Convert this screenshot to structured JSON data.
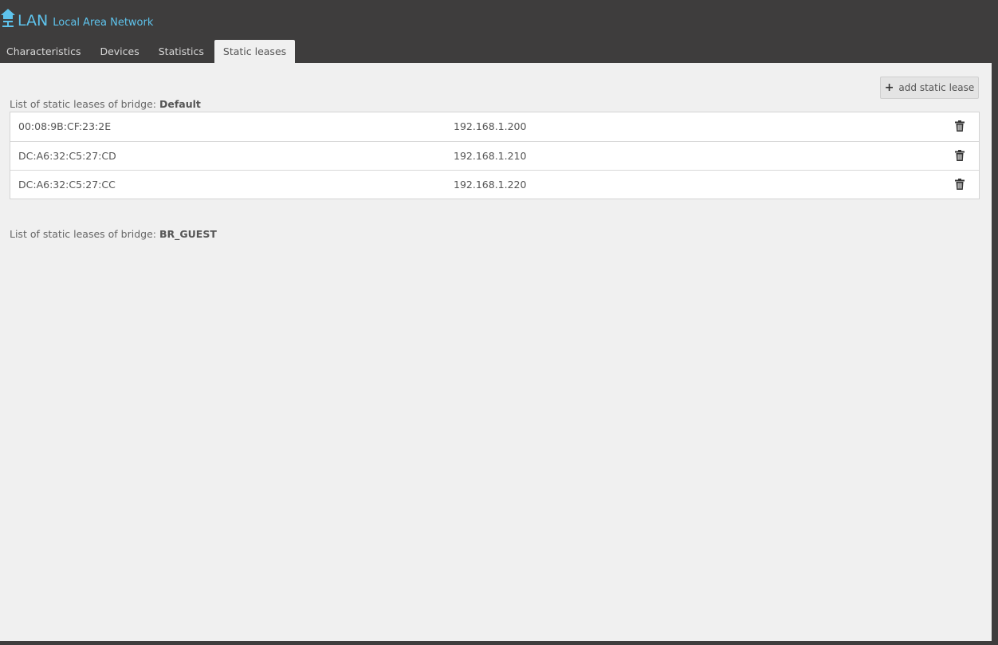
{
  "header": {
    "title": "LAN",
    "subtitle": "Local Area Network",
    "logo_icon": "lan-home-icon"
  },
  "tabs": [
    {
      "label": "Characteristics",
      "active": false
    },
    {
      "label": "Devices",
      "active": false
    },
    {
      "label": "Statistics",
      "active": false
    },
    {
      "label": "Static leases",
      "active": true
    }
  ],
  "toolbar": {
    "add_label": "add static lease",
    "add_icon": "plus-icon"
  },
  "bridges": [
    {
      "label_prefix": "List of static leases of bridge:",
      "name": "Default",
      "leases": [
        {
          "mac": "00:08:9B:CF:23:2E",
          "ip": "192.168.1.200"
        },
        {
          "mac": "DC:A6:32:C5:27:CD",
          "ip": "192.168.1.210"
        },
        {
          "mac": "DC:A6:32:C5:27:CC",
          "ip": "192.168.1.220"
        }
      ]
    },
    {
      "label_prefix": "List of static leases of bridge:",
      "name": "BR_GUEST",
      "leases": []
    }
  ],
  "colors": {
    "header_bg": "#3e3d3d",
    "accent": "#5ec3ec",
    "content_bg": "#f0f0f0"
  }
}
